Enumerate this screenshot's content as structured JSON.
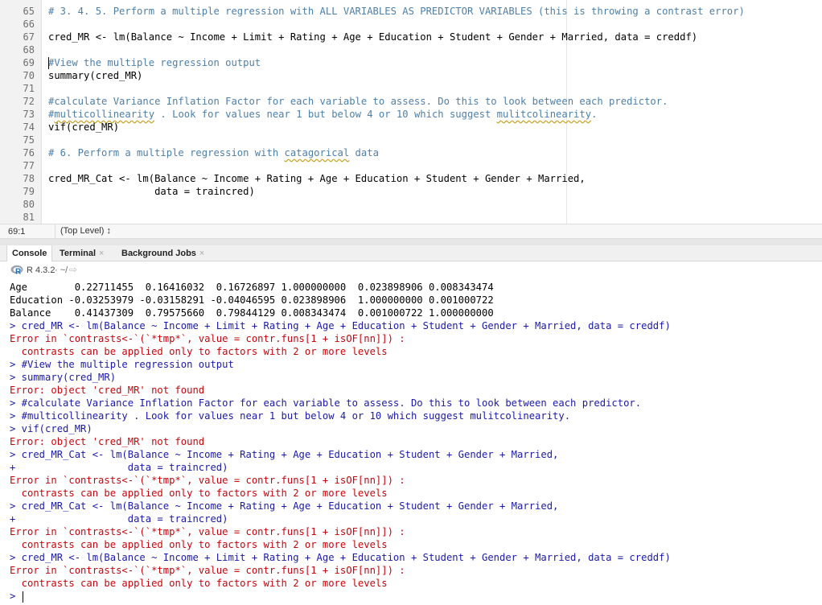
{
  "editor": {
    "lines": [
      {
        "num": "65",
        "segments": [
          {
            "t": "# 3. 4. 5. Perform a multiple regression with ALL VARIABLES AS PREDICTOR VARIABLES (this is throwing a contrast error)",
            "c": "cm"
          }
        ]
      },
      {
        "num": "66",
        "segments": []
      },
      {
        "num": "67",
        "segments": [
          {
            "t": "cred_MR <- lm(Balance ~ Income + Limit + Rating + Age + Education + Student + Gender + Married, data = creddf)",
            "c": ""
          }
        ]
      },
      {
        "num": "68",
        "segments": []
      },
      {
        "num": "69",
        "segments": [
          {
            "t": "#View the multiple regression output",
            "c": "cm"
          }
        ]
      },
      {
        "num": "70",
        "segments": [
          {
            "t": "summary(cred_MR)",
            "c": ""
          }
        ]
      },
      {
        "num": "71",
        "segments": []
      },
      {
        "num": "72",
        "segments": [
          {
            "t": "#calculate Variance Inflation Factor for each variable to assess. Do this to look between each predictor.",
            "c": "cm"
          }
        ]
      },
      {
        "num": "73",
        "segments": [
          {
            "t": "#",
            "c": "cm"
          },
          {
            "t": "multicollinearity",
            "c": "cm sq"
          },
          {
            "t": " . Look for values near 1 but below 4 or 10 which suggest ",
            "c": "cm"
          },
          {
            "t": "mulitcolinearity",
            "c": "cm sq"
          },
          {
            "t": ".",
            "c": "cm"
          }
        ]
      },
      {
        "num": "74",
        "segments": [
          {
            "t": "vif(cred_MR)",
            "c": ""
          }
        ]
      },
      {
        "num": "75",
        "segments": []
      },
      {
        "num": "76",
        "segments": [
          {
            "t": "# 6. Perform a multiple regression with ",
            "c": "cm"
          },
          {
            "t": "catagorical",
            "c": "cm sq"
          },
          {
            "t": " data",
            "c": "cm"
          }
        ]
      },
      {
        "num": "77",
        "segments": []
      },
      {
        "num": "78",
        "segments": [
          {
            "t": "cred_MR_Cat <- lm(Balance ~ Income + Rating + Age + Education + Student + Gender + Married,",
            "c": ""
          }
        ]
      },
      {
        "num": "79",
        "segments": [
          {
            "t": "                  data = traincred)",
            "c": ""
          }
        ]
      },
      {
        "num": "80",
        "segments": []
      },
      {
        "num": "81",
        "segments": []
      }
    ]
  },
  "statusbar": {
    "position": "69:1",
    "scope": "(Top Level) ↕"
  },
  "tabs": [
    {
      "label": "Console",
      "close": ""
    },
    {
      "label": "Terminal",
      "close": "×"
    },
    {
      "label": "Background Jobs",
      "close": "×"
    }
  ],
  "console_header": {
    "r_version": "R 4.3.2",
    "dir": "· ~/",
    "arrow": "⇨"
  },
  "console": {
    "lines": [
      {
        "t": "Age        0.22711455  0.16416032  0.16726897 1.000000000  0.023898906 0.008343474",
        "c": "out"
      },
      {
        "t": "Education -0.03253979 -0.03158291 -0.04046595 0.023898906  1.000000000 0.001000722",
        "c": "out"
      },
      {
        "t": "Balance    0.41437309  0.79575660  0.79844129 0.008343474  0.001000722 1.000000000",
        "c": "out"
      },
      {
        "t": "> cred_MR <- lm(Balance ~ Income + Limit + Rating + Age + Education + Student + Gender + Married, data = creddf)",
        "c": "cmd"
      },
      {
        "t": "Error in `contrasts<-`(`*tmp*`, value = contr.funs[1 + isOF[nn]]) : ",
        "c": "err"
      },
      {
        "t": "  contrasts can be applied only to factors with 2 or more levels",
        "c": "err"
      },
      {
        "t": "> #View the multiple regression output",
        "c": "cmd"
      },
      {
        "t": "> summary(cred_MR)",
        "c": "cmd"
      },
      {
        "t": "Error: object 'cred_MR' not found",
        "c": "err"
      },
      {
        "t": "> #calculate Variance Inflation Factor for each variable to assess. Do this to look between each predictor.",
        "c": "cmd"
      },
      {
        "t": "> #multicollinearity . Look for values near 1 but below 4 or 10 which suggest mulitcolinearity.",
        "c": "cmd"
      },
      {
        "t": "> vif(cred_MR)",
        "c": "cmd"
      },
      {
        "t": "Error: object 'cred_MR' not found",
        "c": "err"
      },
      {
        "t": "> cred_MR_Cat <- lm(Balance ~ Income + Rating + Age + Education + Student + Gender + Married,",
        "c": "cmd"
      },
      {
        "t": "+                   data = traincred)",
        "c": "cmd"
      },
      {
        "t": "Error in `contrasts<-`(`*tmp*`, value = contr.funs[1 + isOF[nn]]) : ",
        "c": "err"
      },
      {
        "t": "  contrasts can be applied only to factors with 2 or more levels",
        "c": "err"
      },
      {
        "t": "> cred_MR_Cat <- lm(Balance ~ Income + Rating + Age + Education + Student + Gender + Married,",
        "c": "cmd"
      },
      {
        "t": "+                   data = traincred)",
        "c": "cmd"
      },
      {
        "t": "Error in `contrasts<-`(`*tmp*`, value = contr.funs[1 + isOF[nn]]) : ",
        "c": "err"
      },
      {
        "t": "  contrasts can be applied only to factors with 2 or more levels",
        "c": "err"
      },
      {
        "t": "> cred_MR <- lm(Balance ~ Income + Limit + Rating + Age + Education + Student + Gender + Married, data = creddf)",
        "c": "cmd"
      },
      {
        "t": "Error in `contrasts<-`(`*tmp*`, value = contr.funs[1 + isOF[nn]]) : ",
        "c": "err"
      },
      {
        "t": "  contrasts can be applied only to factors with 2 or more levels",
        "c": "err"
      },
      {
        "t": "> ",
        "c": "cmd"
      }
    ]
  }
}
